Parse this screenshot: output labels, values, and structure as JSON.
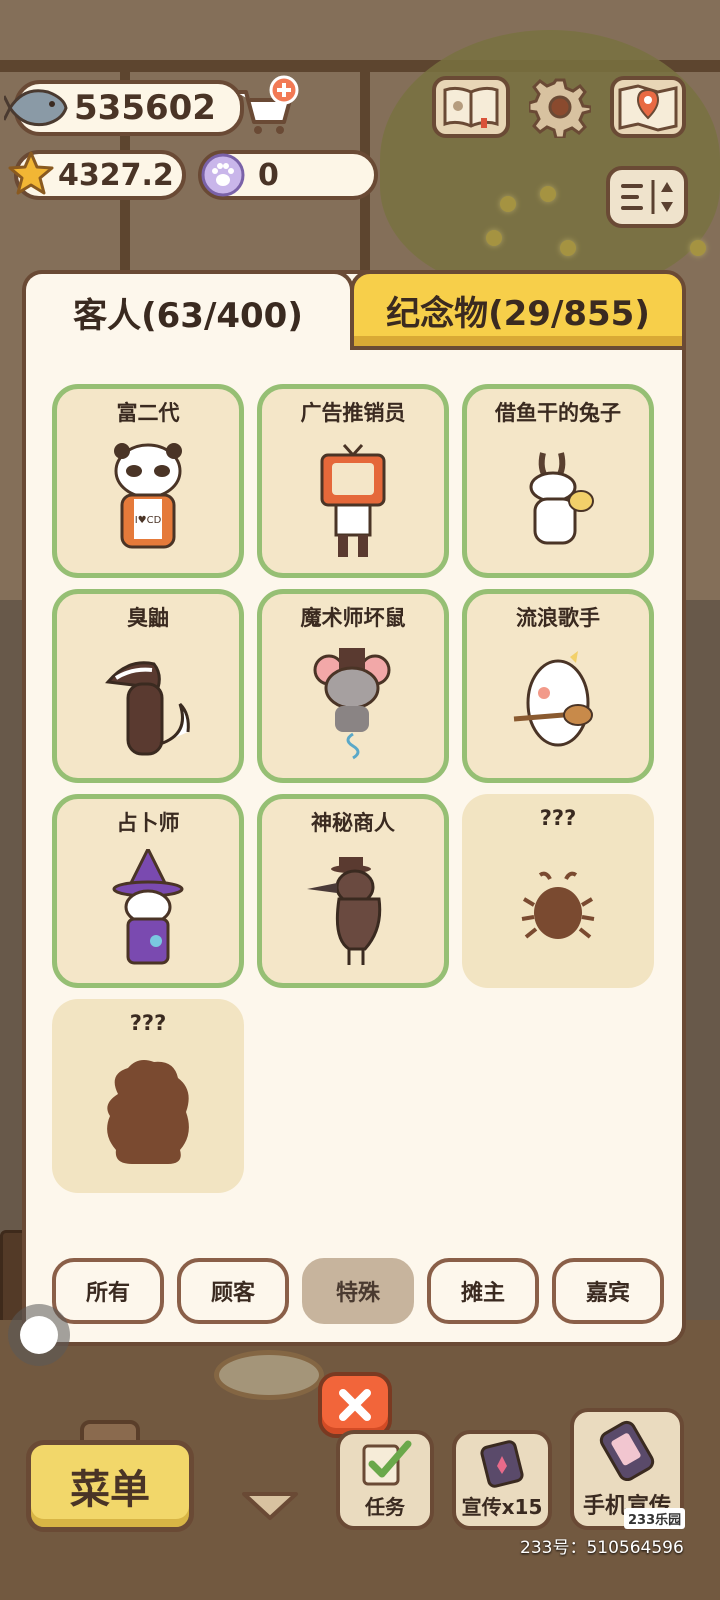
{
  "hud": {
    "fish_count": "535602",
    "stars": "4327.2",
    "paw_points": "0"
  },
  "icons": {
    "currency": "fish-icon",
    "rating": "star-icon",
    "paw": "paw-coin-icon",
    "shop": "cart-plus-icon",
    "catalog": "book-icon",
    "settings": "gear-icon",
    "map": "map-pin-icon",
    "sort": "sort-icon",
    "close": "close-icon"
  },
  "tabs": {
    "guests": "客人(63/400)",
    "souvenirs": "纪念物(29/855)"
  },
  "cards": [
    {
      "name": "富二代",
      "unlocked": true
    },
    {
      "name": "广告推销员",
      "unlocked": true
    },
    {
      "name": "借鱼干的兔子",
      "unlocked": true
    },
    {
      "name": "臭鼬",
      "unlocked": true
    },
    {
      "name": "魔术师坏鼠",
      "unlocked": true
    },
    {
      "name": "流浪歌手",
      "unlocked": true
    },
    {
      "name": "占卜师",
      "unlocked": true
    },
    {
      "name": "神秘商人",
      "unlocked": true
    },
    {
      "name": "???",
      "unlocked": false
    },
    {
      "name": "???",
      "unlocked": false
    }
  ],
  "filters": [
    "所有",
    "顾客",
    "特殊",
    "摊主",
    "嘉宾"
  ],
  "active_filter": "特殊",
  "bottom_bar": {
    "menu": "菜单",
    "tasks": "任务",
    "promo": "宣传x15",
    "phone_promo": "手机宣传"
  },
  "watermark": {
    "logo": "233乐园",
    "id": "233号：510564596"
  },
  "colors": {
    "card_border": "#96bf74",
    "tab_active": "#f7cf4a",
    "close": "#f2653a",
    "menu": "#f2d76a"
  }
}
